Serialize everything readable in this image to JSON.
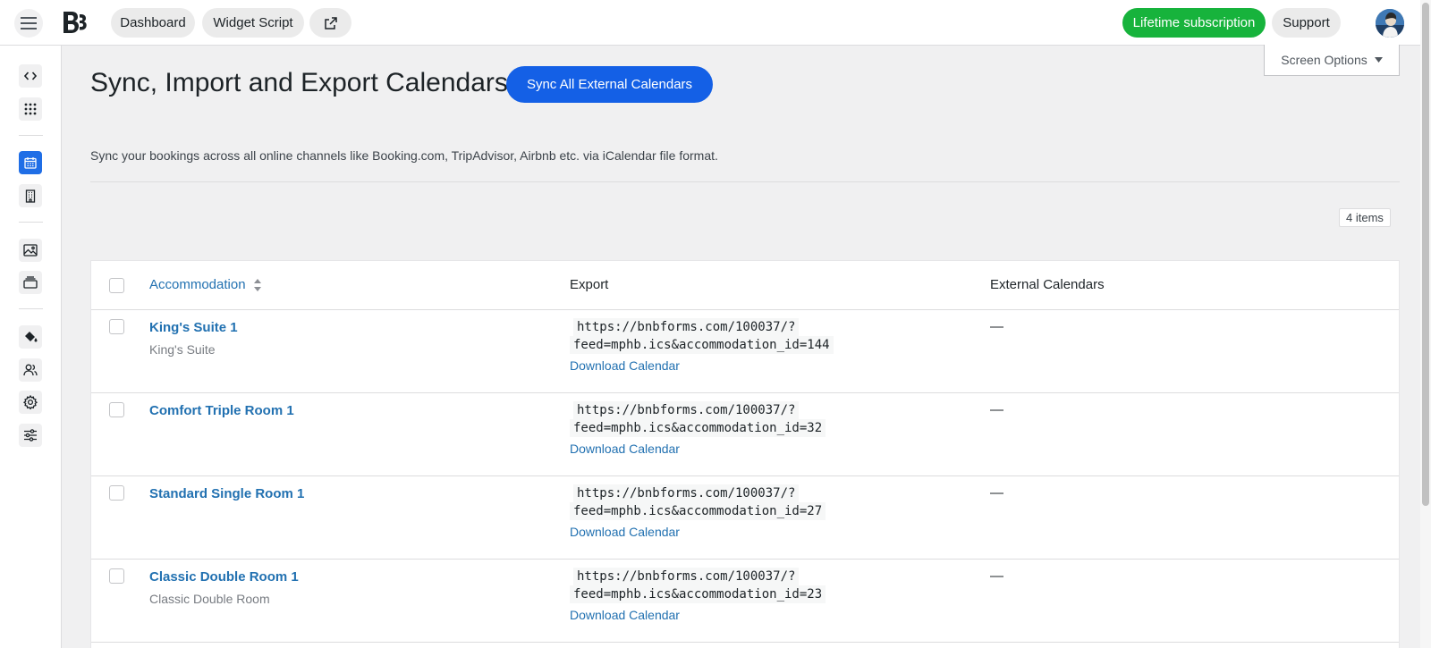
{
  "topbar": {
    "dashboard_label": "Dashboard",
    "widget_script_label": "Widget Script",
    "lifetime_label": "Lifetime subscription",
    "support_label": "Support",
    "accent_green": "#17b33c"
  },
  "sidebar": {
    "icons": [
      "code-icon",
      "apps-grid-icon",
      "calendar-icon",
      "building-icon",
      "image-icon",
      "layers-icon",
      "paint-bucket-icon",
      "users-icon",
      "gear-icon",
      "sliders-icon"
    ],
    "active": "calendar-icon"
  },
  "page": {
    "title": "Sync, Import and Export Calendars",
    "sync_button": "Sync All External Calendars",
    "screen_options": "Screen Options",
    "description": "Sync your bookings across all online channels like Booking.com, TripAdvisor, Airbnb etc. via iCalendar file format.",
    "items_count": "4 items",
    "accent_blue": "#1460e6"
  },
  "table": {
    "headers": {
      "accommodation": "Accommodation",
      "export": "Export",
      "external": "External Calendars"
    },
    "rows": [
      {
        "name": "King's Suite 1",
        "type": "King's Suite",
        "url_line1": "https://bnbforms.com/100037/?",
        "url_line2": "feed=mphb.ics&accommodation_id=144",
        "download": "Download Calendar",
        "external": "—"
      },
      {
        "name": "Comfort Triple Room 1",
        "type": "",
        "url_line1": "https://bnbforms.com/100037/?",
        "url_line2": "feed=mphb.ics&accommodation_id=32",
        "download": "Download Calendar",
        "external": "—"
      },
      {
        "name": "Standard Single Room 1",
        "type": "",
        "url_line1": "https://bnbforms.com/100037/?",
        "url_line2": "feed=mphb.ics&accommodation_id=27",
        "download": "Download Calendar",
        "external": "—"
      },
      {
        "name": "Classic Double Room 1",
        "type": "Classic Double Room",
        "url_line1": "https://bnbforms.com/100037/?",
        "url_line2": "feed=mphb.ics&accommodation_id=23",
        "download": "Download Calendar",
        "external": "—"
      }
    ]
  }
}
